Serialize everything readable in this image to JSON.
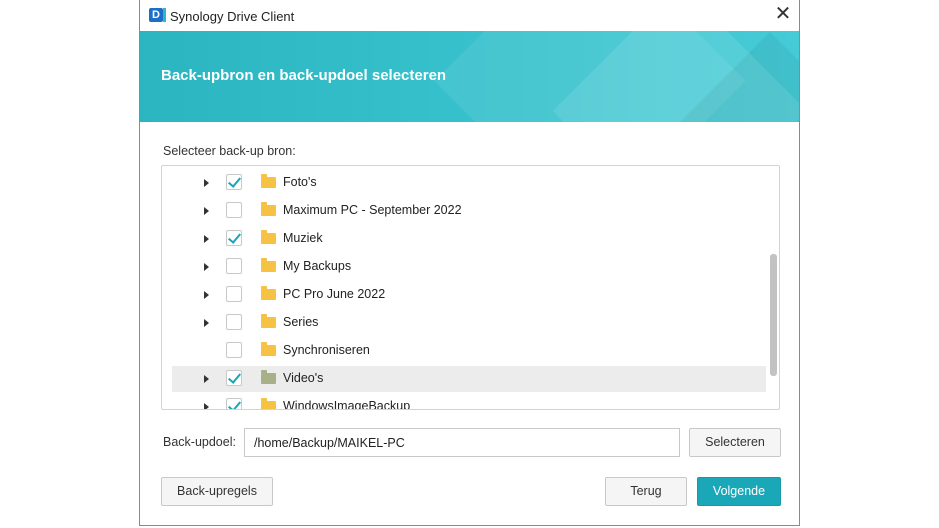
{
  "window": {
    "title": "Synology Drive Client",
    "logo_letter": "D"
  },
  "banner": {
    "title": "Back-upbron en back-updoel selecteren"
  },
  "source": {
    "label": "Selecteer back-up bron:",
    "items": [
      {
        "label": "Foto's",
        "checked": true,
        "expandable": true,
        "selected": false
      },
      {
        "label": "Maximum PC - September 2022",
        "checked": false,
        "expandable": true,
        "selected": false
      },
      {
        "label": "Muziek",
        "checked": true,
        "expandable": true,
        "selected": false
      },
      {
        "label": "My Backups",
        "checked": false,
        "expandable": true,
        "selected": false
      },
      {
        "label": "PC Pro June 2022",
        "checked": false,
        "expandable": true,
        "selected": false
      },
      {
        "label": "Series",
        "checked": false,
        "expandable": true,
        "selected": false
      },
      {
        "label": "Synchroniseren",
        "checked": false,
        "expandable": false,
        "selected": false
      },
      {
        "label": "Video's",
        "checked": true,
        "expandable": true,
        "selected": true
      },
      {
        "label": "WindowsImageBackup",
        "checked": true,
        "expandable": true,
        "selected": false
      }
    ]
  },
  "target": {
    "label": "Back-updoel:",
    "value": "/home/Backup/MAIKEL-PC",
    "select_label": "Selecteren"
  },
  "footer": {
    "rules_label": "Back-upregels",
    "back_label": "Terug",
    "next_label": "Volgende"
  }
}
